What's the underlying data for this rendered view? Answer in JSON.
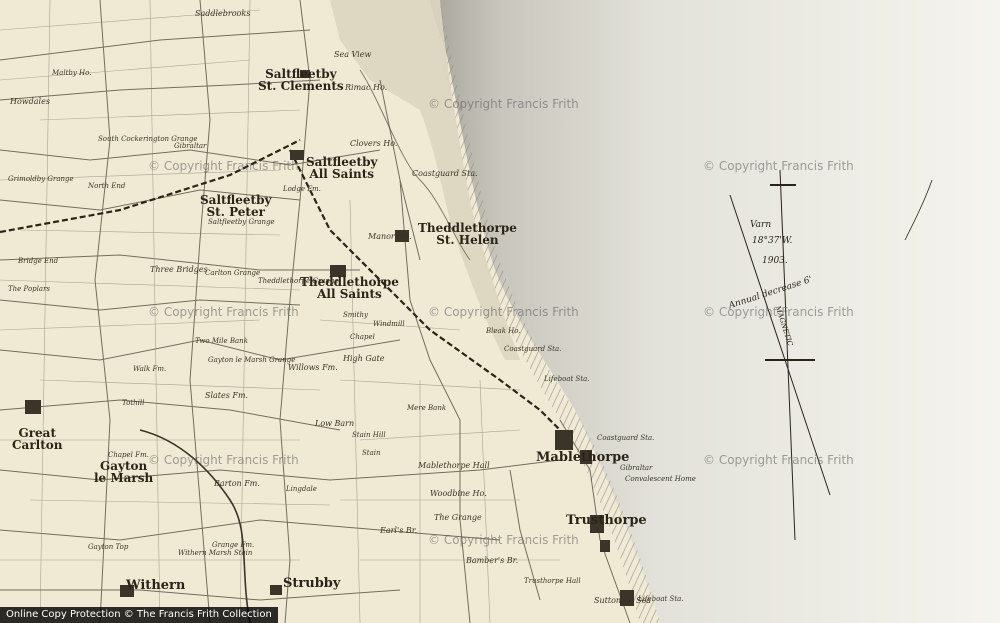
{
  "map": {
    "towns": [
      {
        "id": "saltfleetby-st-clements",
        "lines": [
          "Saltfleetby",
          "St. Clements"
        ]
      },
      {
        "id": "saltfleetby-all-saints",
        "lines": [
          "Saltfleetby",
          "All Saints"
        ]
      },
      {
        "id": "saltfleetby-st-peter",
        "lines": [
          "Saltfleetby",
          "St. Peter"
        ]
      },
      {
        "id": "theddlethorpe-st-helen",
        "lines": [
          "Theddlethorpe",
          "St. Helen"
        ]
      },
      {
        "id": "theddlethorpe-all-saints",
        "lines": [
          "Theddlethorpe",
          "All Saints"
        ]
      },
      {
        "id": "mablethorpe",
        "lines": [
          "Mablethorpe"
        ]
      },
      {
        "id": "trusthorpe",
        "lines": [
          "Trusthorpe"
        ]
      },
      {
        "id": "strubby",
        "lines": [
          "Strubby"
        ]
      },
      {
        "id": "great-carlton",
        "lines": [
          "Great",
          "Carlton"
        ]
      },
      {
        "id": "gayton-le-marsh",
        "lines": [
          "Gayton",
          "le Marsh"
        ]
      },
      {
        "id": "withern",
        "lines": [
          "Withern"
        ]
      }
    ],
    "places": [
      "Saddlebrooks",
      "Sea View",
      "Rimac Ho.",
      "Clovers Ho.",
      "Coastguard Sta.",
      "Manor Ho.",
      "Howdales",
      "South Cockerington Grange",
      "Gibraltar",
      "Saltfleetby Grange",
      "Grimoldby Grange",
      "North End",
      "Three Bridges",
      "Carlton Grange",
      "Theddlethorpe Grange",
      "Lodge Fm.",
      "Smithy",
      "Windmill",
      "Chapel",
      "High Gate",
      "Bleak Ho.",
      "Lifeboat Sta.",
      "Two Mile Bank",
      "Gayton le Marsh Grange",
      "Willows Fm.",
      "Slates Fm.",
      "Low Barn",
      "Stain Hill",
      "Stain",
      "Mere Bank",
      "Mablethorpe Hall",
      "Woodbine Ho.",
      "The Grange",
      "Earl's Br.",
      "Lingdale",
      "Barton Fm.",
      "Grange Fm.",
      "Gayton Top",
      "Bamber's Br.",
      "Trusthorpe Hall",
      "Sutton on Sea",
      "Coastguard Sta.",
      "Gibraltar",
      "Convalescent Home",
      "Maltby Ho.",
      "Tothill",
      "The Poplars",
      "Bridge End",
      "Walk Fm.",
      "Chapel Fm.",
      "Withern Marsh Stain",
      "Coastguard Sta.",
      "Lifeboat Sta."
    ],
    "compass": {
      "var_line1": "Varn",
      "var_line2": "18°37'W.",
      "year": "1903.",
      "annual": "Annual decrease 6'",
      "magnetic": "MAGNETIC"
    },
    "watermark": "© Copyright Francis Frith",
    "footer": "Online Copy Protection © The Francis Frith Collection",
    "colors": {
      "land": "#f1ecd8",
      "sea": "#f4f3ec",
      "beach": "#d3cdb5",
      "road": "#3a3326",
      "rail": "#2a2418"
    }
  }
}
